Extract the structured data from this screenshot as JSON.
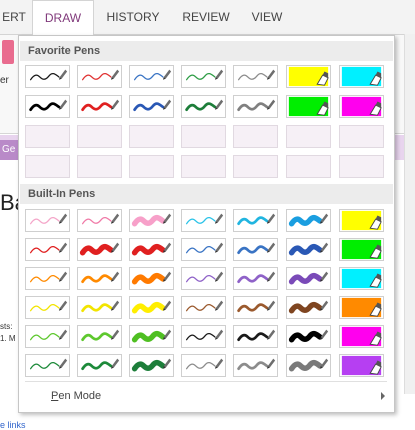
{
  "tabs": [
    {
      "label": "ERT",
      "active": false
    },
    {
      "label": "DRAW",
      "active": true
    },
    {
      "label": "HISTORY",
      "active": false
    },
    {
      "label": "REVIEW",
      "active": false
    },
    {
      "label": "VIEW",
      "active": false
    }
  ],
  "background": {
    "left_partial_text": "er",
    "right_partial_text": "T",
    "gen_tab": "Ge",
    "heading_partial": "Ba",
    "list_line1": "sts:",
    "list_line2": "1. M",
    "links_partial": "e links",
    "right_partial_bold": "r"
  },
  "panel": {
    "favorite_title": "Favorite Pens",
    "builtin_title": "Built-In Pens",
    "pen_mode_label": "Pen Mode",
    "pen_mode_accel": "P",
    "pen_mode_rest": "en Mode",
    "favorite_rows": [
      [
        {
          "kind": "pen",
          "color": "#1a1a1a",
          "w": 1.4
        },
        {
          "kind": "pen",
          "color": "#e03232",
          "w": 1.4
        },
        {
          "kind": "pen",
          "color": "#3a74c4",
          "w": 1.4
        },
        {
          "kind": "pen",
          "color": "#2e9d46",
          "w": 1.4
        },
        {
          "kind": "pen",
          "color": "#8c8c8c",
          "w": 1.4
        },
        {
          "kind": "hl",
          "color": "#ffff00"
        },
        {
          "kind": "hl",
          "color": "#00f0ff"
        }
      ],
      [
        {
          "kind": "pen",
          "color": "#000000",
          "w": 3
        },
        {
          "kind": "pen",
          "color": "#e02020",
          "w": 3
        },
        {
          "kind": "pen",
          "color": "#2a58b5",
          "w": 3
        },
        {
          "kind": "pen",
          "color": "#1d7e3a",
          "w": 3
        },
        {
          "kind": "pen",
          "color": "#808080",
          "w": 3
        },
        {
          "kind": "hl",
          "color": "#00ee00"
        },
        {
          "kind": "hl",
          "color": "#ff00ee"
        }
      ],
      [
        {
          "kind": "empty"
        },
        {
          "kind": "empty"
        },
        {
          "kind": "empty"
        },
        {
          "kind": "empty"
        },
        {
          "kind": "empty"
        },
        {
          "kind": "empty"
        },
        {
          "kind": "empty"
        }
      ],
      [
        {
          "kind": "empty"
        },
        {
          "kind": "empty"
        },
        {
          "kind": "empty"
        },
        {
          "kind": "empty"
        },
        {
          "kind": "empty"
        },
        {
          "kind": "empty"
        },
        {
          "kind": "empty"
        }
      ]
    ],
    "builtin_rows": [
      [
        {
          "kind": "pen",
          "color": "#f4a6c9",
          "w": 1.4
        },
        {
          "kind": "pen",
          "color": "#f07aa7",
          "w": 1.4
        },
        {
          "kind": "pen",
          "color": "#f7a0c9",
          "w": 6
        },
        {
          "kind": "pen",
          "color": "#2bc3e8",
          "w": 1.4
        },
        {
          "kind": "pen",
          "color": "#21b5e0",
          "w": 3
        },
        {
          "kind": "pen",
          "color": "#1a9ee0",
          "w": 6
        },
        {
          "kind": "hl",
          "color": "#ffff00"
        }
      ],
      [
        {
          "kind": "pen",
          "color": "#e02020",
          "w": 1.4
        },
        {
          "kind": "pen",
          "color": "#e02020",
          "w": 6
        },
        {
          "kind": "pen",
          "color": "#e02020",
          "w": 6
        },
        {
          "kind": "pen",
          "color": "#3a74c4",
          "w": 1.4
        },
        {
          "kind": "pen",
          "color": "#3a74c4",
          "w": 3
        },
        {
          "kind": "pen",
          "color": "#2a58b5",
          "w": 6
        },
        {
          "kind": "hl",
          "color": "#00ee00"
        }
      ],
      [
        {
          "kind": "pen",
          "color": "#ff8a00",
          "w": 1.4
        },
        {
          "kind": "pen",
          "color": "#ff8a00",
          "w": 3
        },
        {
          "kind": "pen",
          "color": "#ff7a00",
          "w": 6
        },
        {
          "kind": "pen",
          "color": "#8f62c8",
          "w": 1.4
        },
        {
          "kind": "pen",
          "color": "#8f62c8",
          "w": 3
        },
        {
          "kind": "pen",
          "color": "#7a4ab8",
          "w": 6
        },
        {
          "kind": "hl",
          "color": "#00f0ff"
        }
      ],
      [
        {
          "kind": "pen",
          "color": "#f2e400",
          "w": 1.4
        },
        {
          "kind": "pen",
          "color": "#f2e400",
          "w": 3
        },
        {
          "kind": "pen",
          "color": "#ffee00",
          "w": 6
        },
        {
          "kind": "pen",
          "color": "#9b5a2e",
          "w": 1.4
        },
        {
          "kind": "pen",
          "color": "#9b5a2e",
          "w": 3
        },
        {
          "kind": "pen",
          "color": "#7f4520",
          "w": 6
        },
        {
          "kind": "hl",
          "color": "#ff8a00"
        }
      ],
      [
        {
          "kind": "pen",
          "color": "#5ec82e",
          "w": 1.4
        },
        {
          "kind": "pen",
          "color": "#5ec82e",
          "w": 3
        },
        {
          "kind": "pen",
          "color": "#4fbf22",
          "w": 6
        },
        {
          "kind": "pen",
          "color": "#1a1a1a",
          "w": 1.4
        },
        {
          "kind": "pen",
          "color": "#1a1a1a",
          "w": 3
        },
        {
          "kind": "pen",
          "color": "#000000",
          "w": 6
        },
        {
          "kind": "hl",
          "color": "#ff00ee"
        }
      ],
      [
        {
          "kind": "pen",
          "color": "#1d8a3a",
          "w": 1.4
        },
        {
          "kind": "pen",
          "color": "#1d8a3a",
          "w": 3
        },
        {
          "kind": "pen",
          "color": "#1d7e3a",
          "w": 6
        },
        {
          "kind": "pen",
          "color": "#8c8c8c",
          "w": 1.4
        },
        {
          "kind": "pen",
          "color": "#8c8c8c",
          "w": 3
        },
        {
          "kind": "pen",
          "color": "#7a7a7a",
          "w": 6
        },
        {
          "kind": "hl",
          "color": "#b63ff2"
        }
      ]
    ]
  }
}
